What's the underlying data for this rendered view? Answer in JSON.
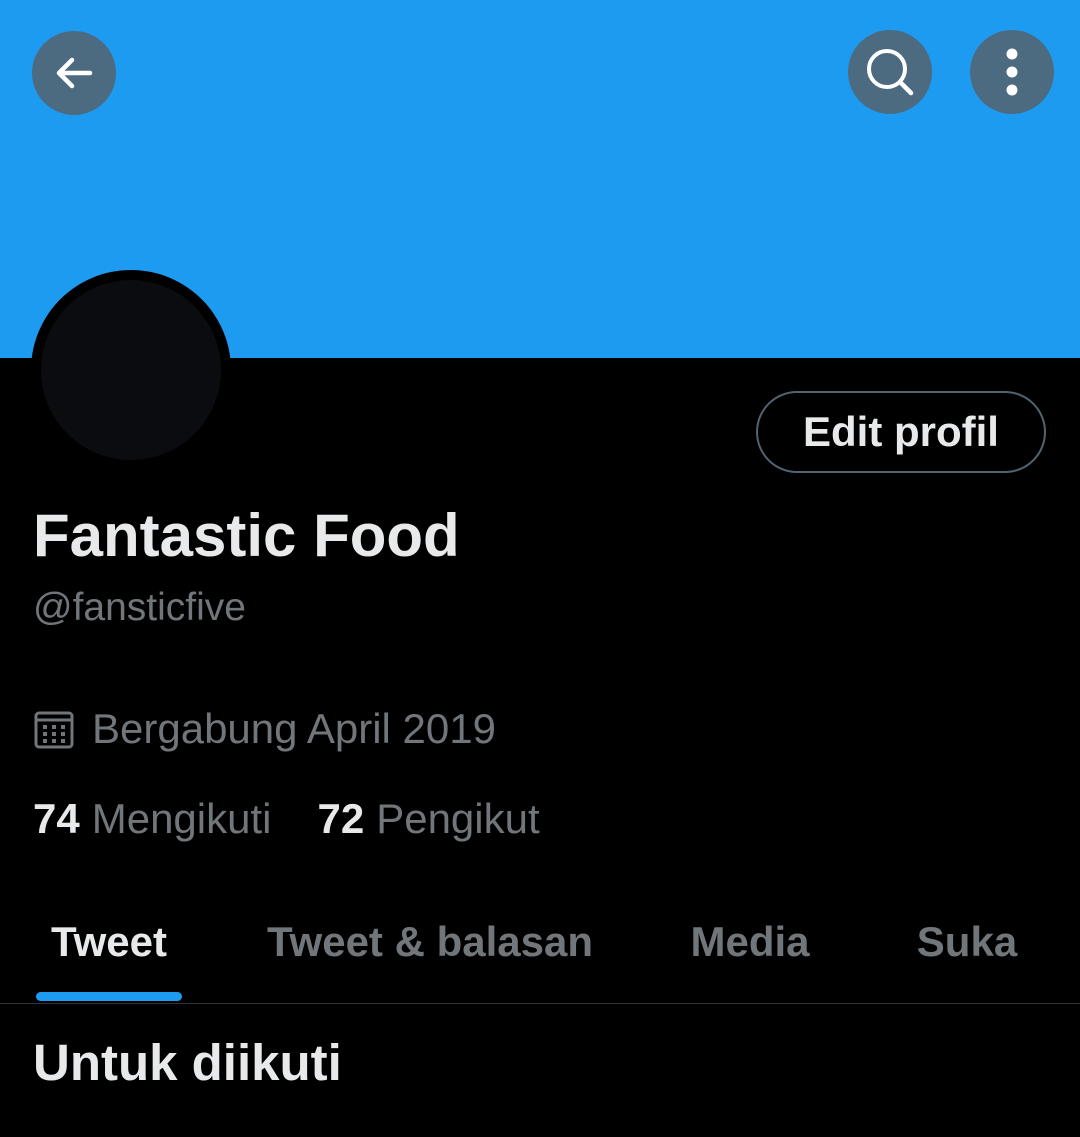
{
  "header": {
    "back_icon": "arrow-left-icon",
    "search_icon": "search-icon",
    "more_icon": "more-vertical-icon",
    "banner_color": "#1d9bf0"
  },
  "profile": {
    "edit_button_label": "Edit profil",
    "display_name": "Fantastic Food",
    "handle": "@fansticfive",
    "joined_icon": "calendar-icon",
    "joined_text": "Bergabung April 2019",
    "following_count": "74",
    "following_label": "Mengikuti",
    "followers_count": "72",
    "followers_label": "Pengikut"
  },
  "tabs": [
    {
      "label": "Tweet",
      "active": true
    },
    {
      "label": "Tweet & balasan",
      "active": false
    },
    {
      "label": "Media",
      "active": false
    },
    {
      "label": "Suka",
      "active": false
    }
  ],
  "colors": {
    "accent": "#1d9bf0",
    "background": "#000000",
    "primary_text": "#e7e9ea",
    "secondary_text": "#71767b"
  },
  "section": {
    "title": "Untuk diikuti"
  }
}
